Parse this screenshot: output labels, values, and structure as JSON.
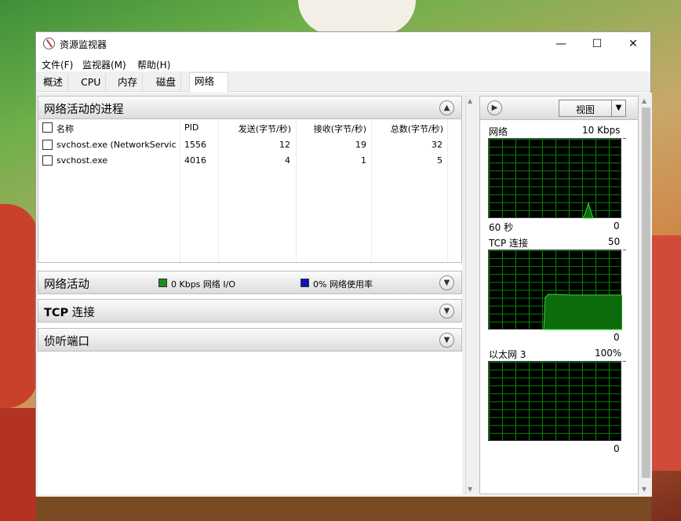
{
  "window": {
    "title": "资源监视器",
    "controls": {
      "minimize": "—",
      "maximize": "☐",
      "close": "✕"
    }
  },
  "menu": [
    "文件(F)",
    "监视器(M)",
    "帮助(H)"
  ],
  "tabs": [
    "概述",
    "CPU",
    "内存",
    "磁盘",
    "网络"
  ],
  "active_tab": "网络",
  "processes": {
    "title": "网络活动的进程",
    "columns": [
      "名称",
      "PID",
      "发送(字节/秒)",
      "接收(字节/秒)",
      "总数(字节/秒)"
    ],
    "rows": [
      {
        "name": "svchost.exe (NetworkServic...",
        "pid": "1556",
        "sent": "12",
        "recv": "19",
        "total": "32"
      },
      {
        "name": "svchost.exe",
        "pid": "4016",
        "sent": "4",
        "recv": "1",
        "total": "5"
      }
    ]
  },
  "network_activity": {
    "title": "网络活动",
    "io_legend": "0 Kbps 网络 I/O",
    "usage_legend": "0% 网络使用率",
    "io_color": "#1d8a1d",
    "usage_color": "#1010c0"
  },
  "tcp": {
    "title_bold": "TCP",
    "title_rest": "连接"
  },
  "ports": {
    "title": "侦听端口"
  },
  "side": {
    "view_label": "视图",
    "graphs": [
      {
        "label": "网络",
        "max": "10 Kbps",
        "time": "60 秒",
        "min": "0"
      },
      {
        "label": "TCP 连接",
        "max": "50",
        "min": "0"
      },
      {
        "label": "以太网 3",
        "max": "100%",
        "min": "0"
      }
    ]
  },
  "icons": {
    "app": "resource-monitor-icon",
    "collapse": "chevron-up-icon",
    "expand": "chevron-down-icon",
    "side_toggle": "chevron-right-icon",
    "dropdown": "dropdown-arrow-icon"
  }
}
